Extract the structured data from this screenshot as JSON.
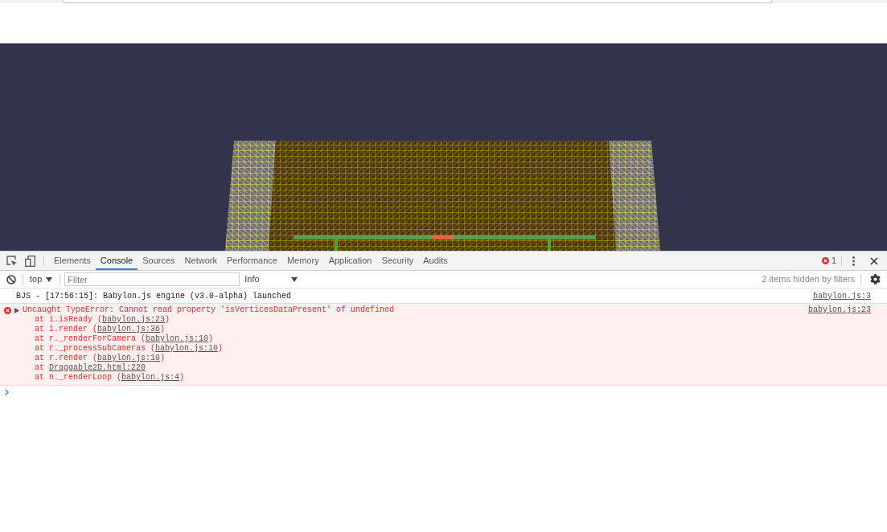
{
  "devtools": {
    "tabs": [
      {
        "label": "Elements",
        "selected": false
      },
      {
        "label": "Console",
        "selected": true
      },
      {
        "label": "Sources",
        "selected": false
      },
      {
        "label": "Network",
        "selected": false
      },
      {
        "label": "Performance",
        "selected": false
      },
      {
        "label": "Memory",
        "selected": false
      },
      {
        "label": "Application",
        "selected": false
      },
      {
        "label": "Security",
        "selected": false
      },
      {
        "label": "Audits",
        "selected": false
      }
    ],
    "error_count": "1"
  },
  "console_toolbar": {
    "context": "top",
    "filter": {
      "placeholder": "Filter"
    },
    "level": "Info",
    "hidden_note": "2 items hidden by filters"
  },
  "console": {
    "messages": [
      {
        "kind": "log",
        "text": "BJS - [17:56:15]: Babylon.js engine (v3.0-alpha) launched",
        "source": "babylon.js:3"
      },
      {
        "kind": "error",
        "expanded": false,
        "text": "Uncaught TypeError: Cannot read property 'isVerticesDataPresent' of undefined",
        "source": "babylon.js:23",
        "stack": [
          {
            "text_before": "at i.isReady (",
            "link": "babylon.js:23",
            "text_after": ")"
          },
          {
            "text_before": "at i.render (",
            "link": "babylon.js:36",
            "text_after": ")"
          },
          {
            "text_before": "at r._renderForCamera (",
            "link": "babylon.js:10",
            "text_after": ")"
          },
          {
            "text_before": "at r._processSubCameras (",
            "link": "babylon.js:10",
            "text_after": ")"
          },
          {
            "text_before": "at r.render (",
            "link": "babylon.js:10",
            "text_after": ")"
          },
          {
            "text_before": "at ",
            "link": "Draggable2D.html:220"
          },
          {
            "text_before": "at n._renderLoop (",
            "link": "babylon.js:4",
            "text_after": ")"
          }
        ]
      }
    ]
  }
}
